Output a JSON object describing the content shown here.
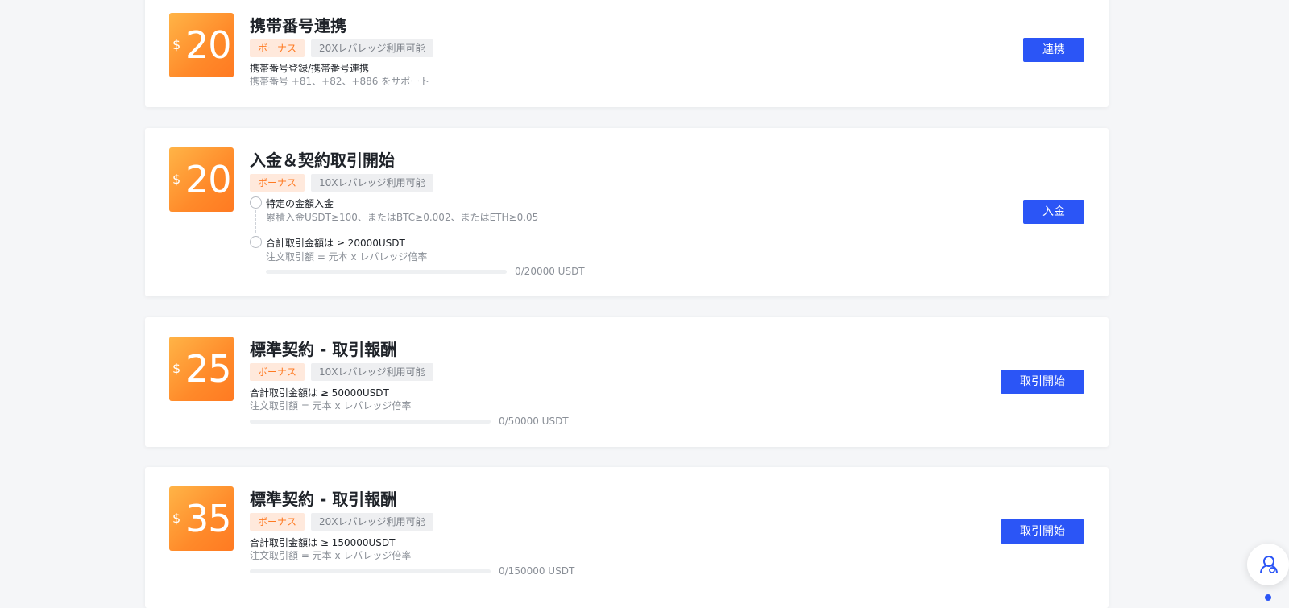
{
  "cards": [
    {
      "currency": "$",
      "amount": "20",
      "title": "携帯番号連携",
      "bonus_tag": "ボーナス",
      "leverage_tag": "20Xレバレッジ利用可能",
      "desc": "携帯番号登録/携帯番号連携",
      "subdesc": "携帯番号 +81、+82、+886 をサポート",
      "button": "連携"
    },
    {
      "currency": "$",
      "amount": "20",
      "title": "入金＆契約取引開始",
      "bonus_tag": "ボーナス",
      "leverage_tag": "10Xレバレッジ利用可能",
      "steps": [
        {
          "text": "特定の金額入金",
          "sub": "累積入金USDT≥100、またはBTC≥0.002、またはETH≥0.05"
        },
        {
          "text": "合計取引金額は ≥ 20000USDT",
          "sub": "注文取引額 = 元本 x レバレッジ倍率"
        }
      ],
      "progress": 0,
      "progress_label": "0/20000 USDT",
      "button": "入金"
    },
    {
      "currency": "$",
      "amount": "25",
      "title": "標準契約 - 取引報酬",
      "bonus_tag": "ボーナス",
      "leverage_tag": "10Xレバレッジ利用可能",
      "desc": "合計取引金額は ≥ 50000USDT",
      "subdesc": "注文取引額 = 元本 x レバレッジ倍率",
      "progress": 0,
      "progress_label": "0/50000 USDT",
      "button": "取引開始"
    },
    {
      "currency": "$",
      "amount": "35",
      "title": "標準契約 - 取引報酬",
      "bonus_tag": "ボーナス",
      "leverage_tag": "20Xレバレッジ利用可能",
      "desc": "合計取引金額は ≥ 150000USDT",
      "subdesc": "注文取引額 = 元本 x レバレッジ倍率",
      "progress": 0,
      "progress_label": "0/150000 USDT",
      "button": "取引開始"
    }
  ],
  "support": {
    "icon": "customer-service-icon"
  },
  "colors": {
    "accent": "#2b55f6",
    "badge": "#ff8a2a",
    "bonus_text": "#ff7a22"
  }
}
